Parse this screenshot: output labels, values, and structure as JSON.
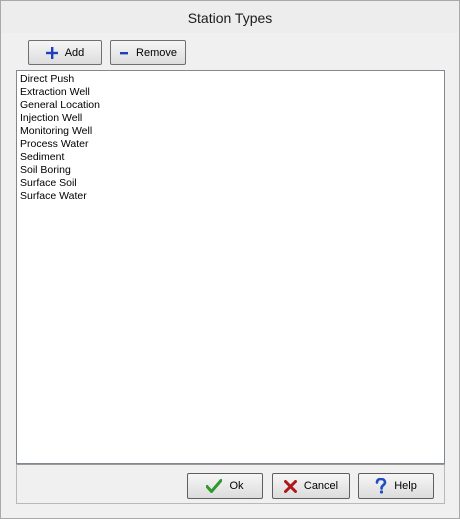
{
  "window": {
    "title": "Station Types"
  },
  "toolbar": {
    "add_label": "Add",
    "remove_label": "Remove"
  },
  "station_types": [
    "Direct Push",
    "Extraction Well",
    "General Location",
    "Injection Well",
    "Monitoring Well",
    "Process Water",
    "Sediment",
    "Soil Boring",
    "Surface Soil",
    "Surface Water"
  ],
  "footer": {
    "ok_label": "Ok",
    "cancel_label": "Cancel",
    "help_label": "Help"
  },
  "icons": {
    "add": "plus-icon",
    "remove": "minus-icon",
    "ok": "checkmark-icon",
    "cancel": "x-icon",
    "help": "question-icon"
  },
  "colors": {
    "plus": "#1f3fbf",
    "minus": "#1f3fbf",
    "check": "#2e9a2e",
    "x": "#b01818",
    "question": "#1f4fbf"
  }
}
